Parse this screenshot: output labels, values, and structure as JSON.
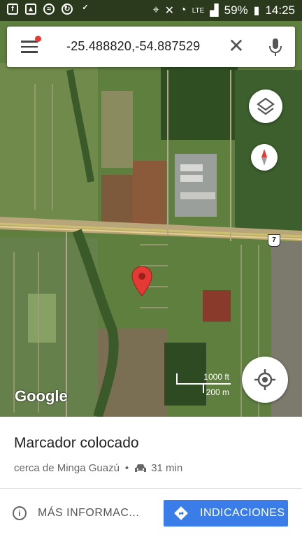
{
  "status_bar": {
    "left_icons": [
      "facebook-icon",
      "image-icon",
      "wifi-icon",
      "sync-icon",
      "checklist-icon"
    ],
    "lte_label": "LTE",
    "battery_percent": "59%",
    "time": "14:25"
  },
  "search": {
    "query": "-25.488820,-54.887529"
  },
  "map": {
    "route_number": "7",
    "logo": "Google",
    "scale_imperial": "1000 ft",
    "scale_metric": "200 m"
  },
  "place": {
    "title": "Marcador colocado",
    "near": "cerca de Minga Guazú",
    "separator": "•",
    "travel_time": "31 min"
  },
  "actions": {
    "more_info_label": "MÁS INFORMAC...",
    "directions_label": "INDICACIONES"
  },
  "colors": {
    "accent": "#3b7de8",
    "pin": "#e53935"
  }
}
